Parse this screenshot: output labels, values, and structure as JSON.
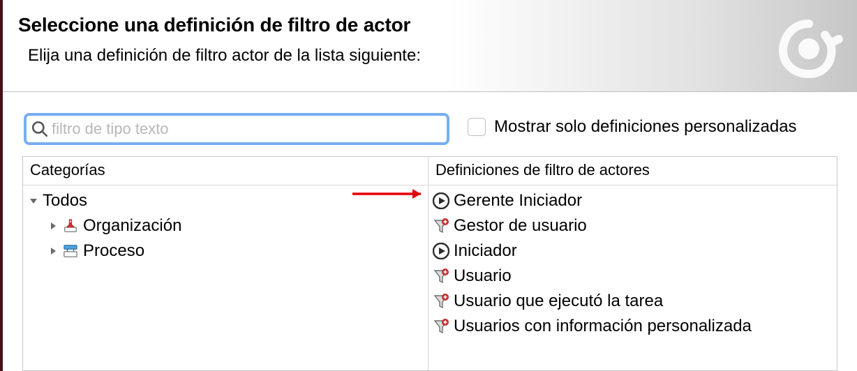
{
  "header": {
    "title": "Seleccione una definición de filtro de actor",
    "subtitle": "Elija una definición de filtro actor de la lista siguiente:"
  },
  "search": {
    "placeholder": "filtro de tipo texto",
    "value": ""
  },
  "checkbox": {
    "label": "Mostrar solo definiciones personalizadas",
    "checked": false
  },
  "categories": {
    "header": "Categorías",
    "root": {
      "label": "Todos",
      "expanded": true,
      "children": [
        {
          "label": "Organización",
          "icon": "pin-icon",
          "expanded": false
        },
        {
          "label": "Proceso",
          "icon": "process-icon",
          "expanded": false
        }
      ]
    }
  },
  "definitions": {
    "header": "Definiciones de filtro de actores",
    "items": [
      {
        "label": "Gerente Iniciador",
        "icon": "play-circle-icon"
      },
      {
        "label": "Gestor de usuario",
        "icon": "funnel-plus-icon"
      },
      {
        "label": "Iniciador",
        "icon": "play-circle-icon"
      },
      {
        "label": "Usuario",
        "icon": "funnel-plus-icon"
      },
      {
        "label": "Usuario que ejecutó la tarea",
        "icon": "funnel-plus-icon"
      },
      {
        "label": "Usuarios con información personalizada",
        "icon": "funnel-plus-icon"
      }
    ]
  }
}
